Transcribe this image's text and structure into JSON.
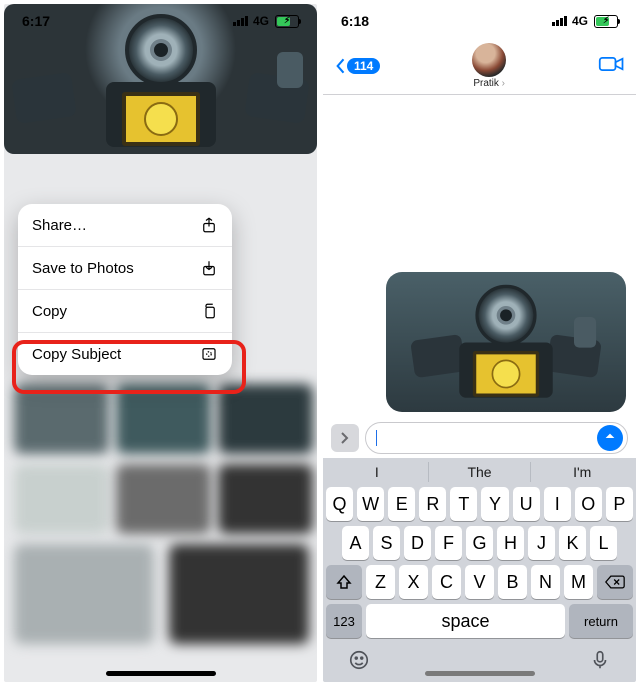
{
  "left": {
    "time": "6:17",
    "network": "4G",
    "menu": [
      {
        "label": "Share…",
        "icon": "share-icon"
      },
      {
        "label": "Save to Photos",
        "icon": "download-icon"
      },
      {
        "label": "Copy",
        "icon": "copy-doc-icon"
      },
      {
        "label": "Copy Subject",
        "icon": "copy-subject-icon"
      }
    ]
  },
  "right": {
    "time": "6:18",
    "network": "4G",
    "back_count": "114",
    "contact_name": "Pratik",
    "suggestions": [
      "I",
      "The",
      "I'm"
    ],
    "keys_r1": [
      "Q",
      "W",
      "E",
      "R",
      "T",
      "Y",
      "U",
      "I",
      "O",
      "P"
    ],
    "keys_r2": [
      "A",
      "S",
      "D",
      "F",
      "G",
      "H",
      "J",
      "K",
      "L"
    ],
    "keys_r3": [
      "Z",
      "X",
      "C",
      "V",
      "B",
      "N",
      "M"
    ],
    "key_123": "123",
    "key_space": "space",
    "key_return": "return"
  }
}
